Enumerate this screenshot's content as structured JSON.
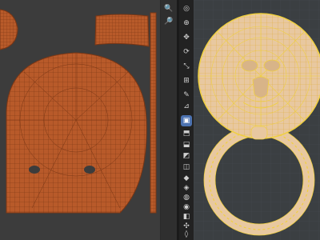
{
  "uv_editor": {
    "islands": [
      "head-island",
      "strip-island",
      "tall-strip-island",
      "face-island"
    ]
  },
  "uv_nav": {
    "buttons": [
      {
        "name": "zoom-in-icon",
        "glyph": "🔍"
      },
      {
        "name": "zoom-out-icon",
        "glyph": "🔎"
      }
    ]
  },
  "toolbar": {
    "tools": [
      {
        "name": "select-tool-icon",
        "glyph": "◎",
        "active": false
      },
      {
        "name": "cursor-tool-icon",
        "glyph": "⊕",
        "active": false
      },
      {
        "name": "move-tool-icon",
        "glyph": "✥",
        "active": false
      },
      {
        "name": "rotate-tool-icon",
        "glyph": "⟳",
        "active": false
      },
      {
        "name": "scale-tool-icon",
        "glyph": "⤡",
        "active": false
      },
      {
        "name": "transform-tool-icon",
        "glyph": "⊞",
        "active": false
      },
      {
        "name": "annotate-tool-icon",
        "glyph": "✎",
        "active": false
      },
      {
        "name": "measure-tool-icon",
        "glyph": "⊿",
        "active": false
      },
      {
        "name": "add-cube-tool-icon",
        "glyph": "▣",
        "active": true
      },
      {
        "name": "extrude-tool-icon",
        "glyph": "⬒",
        "active": false
      },
      {
        "name": "inset-tool-icon",
        "glyph": "⬓",
        "active": false
      },
      {
        "name": "bevel-tool-icon",
        "glyph": "◩",
        "active": false
      },
      {
        "name": "loop-cut-tool-icon",
        "glyph": "◫",
        "active": false
      },
      {
        "name": "knife-tool-icon",
        "glyph": "◆",
        "active": false
      },
      {
        "name": "poly-build-tool-icon",
        "glyph": "◈",
        "active": false
      },
      {
        "name": "spin-tool-icon",
        "glyph": "◍",
        "active": false
      },
      {
        "name": "smooth-tool-icon",
        "glyph": "◉",
        "active": false
      },
      {
        "name": "edge-slide-tool-icon",
        "glyph": "◧",
        "active": false
      },
      {
        "name": "shrink-tool-icon",
        "glyph": "✣",
        "active": false
      },
      {
        "name": "shear-tool-icon",
        "glyph": "◊",
        "active": false
      },
      {
        "name": "rip-tool-icon",
        "glyph": "◌",
        "active": false
      }
    ]
  },
  "colors": {
    "uv_fill": "#b85a2a",
    "uv_line": "#7a3614",
    "viewport_bg": "#3b3f42",
    "mesh_fill": "#e8c8a0",
    "mesh_wire": "#f0d040",
    "active_tool": "#4c72b0"
  }
}
